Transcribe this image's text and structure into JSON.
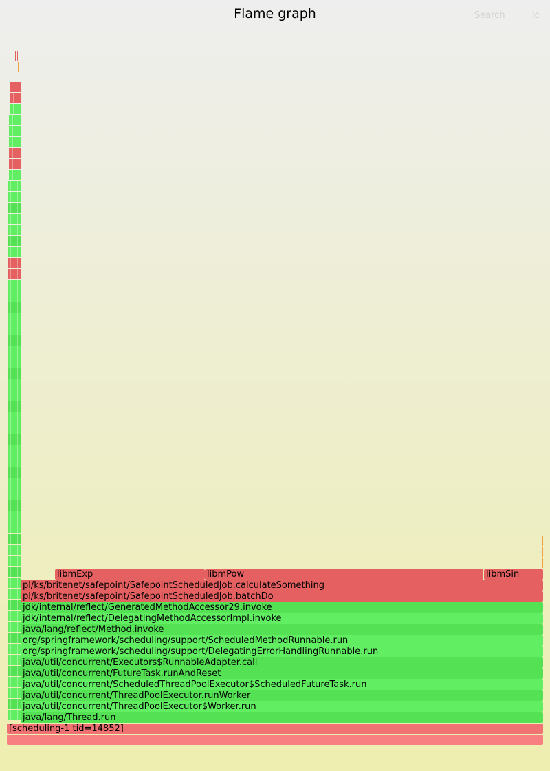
{
  "header": {
    "title": "Flame graph",
    "search_label": "Search",
    "ic_label": "ic"
  },
  "colors": {
    "background_top": "#eeeeee",
    "background_bottom": "#eeeeb0",
    "root": "#f98080",
    "thread": "#f07272",
    "java_green_a": "#54e254",
    "java_green_b": "#62ee62",
    "native_red": "#e56060",
    "tick_yellow": "#e8d060",
    "tick_orange": "#f0a040"
  },
  "frames": [
    {
      "name": "root",
      "label": "",
      "color": "root"
    },
    {
      "name": "thread",
      "label": "[scheduling-1 tid=14852]",
      "color": "thread"
    },
    {
      "name": "thread-run",
      "label": "java/lang/Thread.run",
      "color": "java_green_a"
    },
    {
      "name": "worker-run",
      "label": "java/util/concurrent/ThreadPoolExecutor$Worker.run",
      "color": "java_green_b"
    },
    {
      "name": "run-worker",
      "label": "java/util/concurrent/ThreadPoolExecutor.runWorker",
      "color": "java_green_a"
    },
    {
      "name": "scheduled-future-task-run",
      "label": "java/util/concurrent/ScheduledThreadPoolExecutor$ScheduledFutureTask.run",
      "color": "java_green_b"
    },
    {
      "name": "future-task-run-and-reset",
      "label": "java/util/concurrent/FutureTask.runAndReset",
      "color": "java_green_a"
    },
    {
      "name": "runnable-adapter-call",
      "label": "java/util/concurrent/Executors$RunnableAdapter.call",
      "color": "java_green_a"
    },
    {
      "name": "delegating-error-handling-runnable",
      "label": "org/springframework/scheduling/support/DelegatingErrorHandlingRunnable.run",
      "color": "java_green_b"
    },
    {
      "name": "scheduled-method-runnable",
      "label": "org/springframework/scheduling/support/ScheduledMethodRunnable.run",
      "color": "java_green_b"
    },
    {
      "name": "method-invoke",
      "label": "java/lang/reflect/Method.invoke",
      "color": "java_green_a"
    },
    {
      "name": "delegating-method-accessor",
      "label": "jdk/internal/reflect/DelegatingMethodAccessorImpl.invoke",
      "color": "java_green_b"
    },
    {
      "name": "generated-method-accessor",
      "label": "jdk/internal/reflect/GeneratedMethodAccessor29.invoke",
      "color": "java_green_a"
    },
    {
      "name": "batch-do",
      "label": "pl/ks/britenet/safepoint/SafepointScheduledJob.batchDo",
      "color": "native_red"
    },
    {
      "name": "calculate-something",
      "label": "pl/ks/britenet/safepoint/SafepointScheduledJob.calculateSomething",
      "color": "native_red"
    }
  ],
  "leaf_frames": [
    {
      "name": "libm-exp",
      "label": "libmExp",
      "color": "native_red"
    },
    {
      "name": "libm-pow",
      "label": "libmPow",
      "color": "native_red"
    },
    {
      "name": "libm-sin",
      "label": "libmSin",
      "color": "native_red"
    }
  ]
}
